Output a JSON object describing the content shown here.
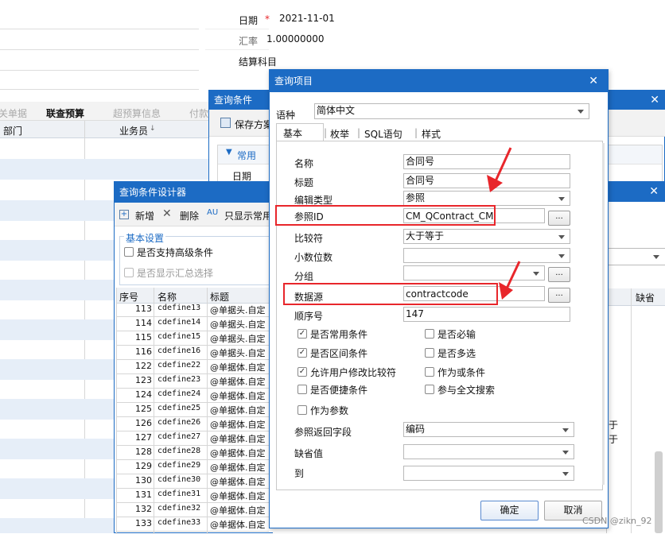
{
  "top_form": {
    "date_label": "日期",
    "required_mark": "*",
    "date_value": "2021-11-01",
    "rate_label": "汇率",
    "rate_value": "1.00000000",
    "account_label": "结算科目"
  },
  "bg_tabs": [
    "关单据",
    "联查预算",
    "超预算信息",
    "付款"
  ],
  "bg_grid_headers": {
    "dept": "部门",
    "staff": "业务员",
    "sort_mark": "↓"
  },
  "query_cond": {
    "title": "查询条件",
    "save_scheme": "保存方案",
    "common_section": "常用",
    "date_label": "日期"
  },
  "designer": {
    "title": "查询条件设计器",
    "toolbar": {
      "add": "新增",
      "delete": "删除",
      "show_common": "只显示常用"
    },
    "basic_section": "基本设置",
    "chk_advanced": "是否支持高级条件",
    "chk_summary": "是否显示汇总选择",
    "columns": [
      "序号",
      "名称",
      "标题"
    ],
    "rows": [
      {
        "no": "113",
        "name": "cdefine13",
        "title": "@单据头.自定"
      },
      {
        "no": "114",
        "name": "cdefine14",
        "title": "@单据头.自定"
      },
      {
        "no": "115",
        "name": "cdefine15",
        "title": "@单据头.自定"
      },
      {
        "no": "116",
        "name": "cdefine16",
        "title": "@单据头.自定"
      },
      {
        "no": "122",
        "name": "cdefine22",
        "title": "@单据体.自定"
      },
      {
        "no": "123",
        "name": "cdefine23",
        "title": "@单据体.自定"
      },
      {
        "no": "124",
        "name": "cdefine24",
        "title": "@单据体.自定"
      },
      {
        "no": "125",
        "name": "cdefine25",
        "title": "@单据体.自定"
      },
      {
        "no": "126",
        "name": "cdefine26",
        "title": "@单据体.自定"
      },
      {
        "no": "127",
        "name": "cdefine27",
        "title": "@单据体.自定"
      },
      {
        "no": "128",
        "name": "cdefine28",
        "title": "@单据体.自定"
      },
      {
        "no": "129",
        "name": "cdefine29",
        "title": "@单据体.自定"
      },
      {
        "no": "130",
        "name": "cdefine30",
        "title": "@单据体.自定"
      },
      {
        "no": "131",
        "name": "cdefine31",
        "title": "@单据体.自定"
      },
      {
        "no": "132",
        "name": "cdefine32",
        "title": "@单据体.自定"
      },
      {
        "no": "133",
        "name": "cdefine33",
        "title": "@单据体.自定"
      }
    ],
    "right_col_header": "缺省",
    "right_col_partial": "于"
  },
  "dialog": {
    "title": "查询项目",
    "lang_label": "语种",
    "lang_value": "简体中文",
    "tabs": [
      "基本",
      "枚举",
      "SQL语句",
      "样式"
    ],
    "fields": {
      "name_label": "名称",
      "name_value": "合同号",
      "caption_label": "标题",
      "caption_value": "合同号",
      "edit_type_label": "编辑类型",
      "edit_type_value": "参照",
      "ref_id_label": "参照ID",
      "ref_id_value": "CM_QContract_CM",
      "compare_label": "比较符",
      "compare_value": "大于等于",
      "decimals_label": "小数位数",
      "decimals_value": "",
      "group_label": "分组",
      "group_value": "",
      "datasource_label": "数据源",
      "datasource_value": "contractcode",
      "order_label": "顺序号",
      "order_value": "147",
      "return_field_label": "参照返回字段",
      "return_field_value": "编码",
      "default_label": "缺省值",
      "default_value": "",
      "to_label": "到",
      "to_value": ""
    },
    "checks": {
      "common": "是否常用条件",
      "required": "是否必输",
      "range": "是否区间条件",
      "multi": "是否多选",
      "allow_cmp": "允许用户修改比较符",
      "or_cond": "作为或条件",
      "quick": "是否便捷条件",
      "fulltext": "参与全文搜索",
      "as_param": "作为参数"
    },
    "ok": "确定",
    "cancel": "取消",
    "dots": "..."
  },
  "watermark": "CSDN @zikn_92"
}
